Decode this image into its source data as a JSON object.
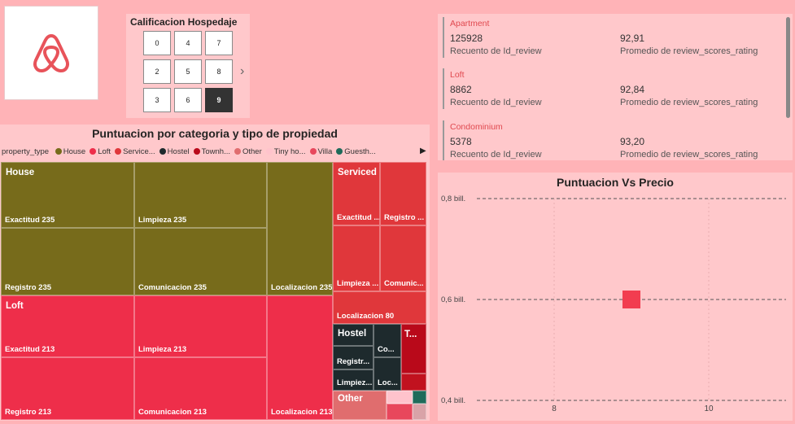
{
  "slicer": {
    "title": "Calificacion Hospedaje",
    "options": [
      "0",
      "4",
      "7",
      "2",
      "5",
      "8",
      "3",
      "6",
      "9"
    ],
    "selected": "9",
    "next_icon": "chevron-right-icon"
  },
  "logo": {
    "icon": "airbnb-logo-icon",
    "color": "#E8535A"
  },
  "treemap": {
    "title": "Puntuacion por categoria y tipo de propiedad",
    "legend_title": "property_type",
    "legend": [
      {
        "label": "House",
        "color": "#776B1B"
      },
      {
        "label": "Loft",
        "color": "#EE2E4A"
      },
      {
        "label": "Service...",
        "color": "#E0373B"
      },
      {
        "label": "Hostel",
        "color": "#1E2A2D"
      },
      {
        "label": "Townh...",
        "color": "#B9091A"
      },
      {
        "label": "Other",
        "color": "#E06D6E"
      },
      {
        "label": "Tiny ho...",
        "color": "#FFC3CC"
      },
      {
        "label": "Villa",
        "color": "#E8475C"
      },
      {
        "label": "Guesth...",
        "color": "#1F6B5A"
      }
    ],
    "groups": {
      "house": "House",
      "loft": "Loft",
      "serviced": "Serviced apartm...",
      "hostel": "Hostel",
      "townhouse": "T...",
      "other": "Other"
    },
    "tiles": {
      "house_exactitud": "Exactitud 235",
      "house_limpieza": "Limpieza 235",
      "house_registro": "Registro 235",
      "house_comunicacion": "Comunicacion 235",
      "house_localizacion": "Localizacion 235",
      "loft_exactitud": "Exactitud 213",
      "loft_limpieza": "Limpieza 213",
      "loft_registro": "Registro 213",
      "loft_comunicacion": "Comunicacion 213",
      "loft_localizacion": "Localizacion 213",
      "sa_exactitud": "Exactitud ...",
      "sa_registro": "Registro ...",
      "sa_limpieza": "Limpieza ...",
      "sa_comunicacion": "Comunic...",
      "sa_localizacion": "Localizacion 80",
      "hostel_registro": "Registr...",
      "hostel_co": "Co...",
      "hostel_limpieza": "Limpiez...",
      "hostel_loc": "Loc..."
    }
  },
  "cards": [
    {
      "category": "Apartment",
      "count": "125928",
      "count_label": "Recuento de Id_review",
      "avg": "92,91",
      "avg_label": "Promedio de review_scores_rating"
    },
    {
      "category": "Loft",
      "count": "8862",
      "count_label": "Recuento de Id_review",
      "avg": "92,84",
      "avg_label": "Promedio de review_scores_rating"
    },
    {
      "category": "Condominium",
      "count": "5378",
      "count_label": "Recuento de Id_review",
      "avg": "93,20",
      "avg_label": "Promedio de review_scores_rating"
    }
  ],
  "chart_data": {
    "type": "scatter",
    "title": "Puntuacion Vs Precio",
    "y_ticks": [
      "0,8 bill.",
      "0,6 bill.",
      "0,4 bill."
    ],
    "x_ticks": [
      "8",
      "10"
    ],
    "points": [
      {
        "x": 9,
        "y": 0.6,
        "color": "#F23D50"
      }
    ],
    "xlim": [
      7,
      11
    ],
    "ylim": [
      0.4,
      0.8
    ],
    "grid": true
  }
}
